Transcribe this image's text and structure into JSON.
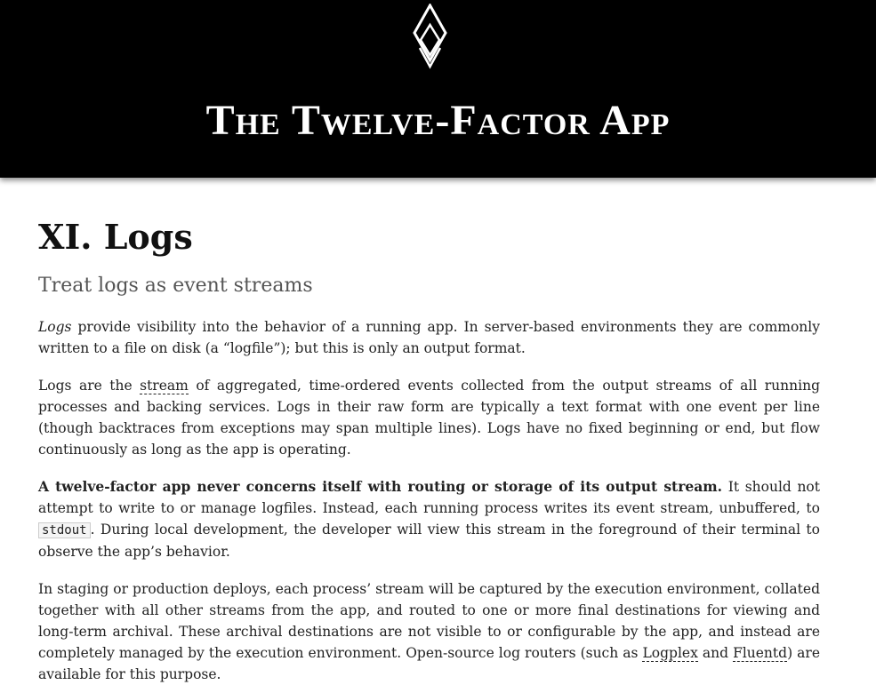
{
  "header": {
    "logo_icon": "diamond-logo-icon",
    "title": "The Twelve-Factor App"
  },
  "article": {
    "title": "XI. Logs",
    "subtitle": "Treat logs as event streams",
    "p1": {
      "em": "Logs",
      "text": " provide visibility into the behavior of a running app. In server-based environments they are commonly written to a file on disk (a “logfile”); but this is only an output format."
    },
    "p2": {
      "before": "Logs are the ",
      "link": "stream",
      "after": " of aggregated, time-ordered events collected from the output streams of all running processes and backing services. Logs in their raw form are typically a text format with one event per line (though backtraces from exceptions may span multiple lines). Logs have no fixed beginning or end, but flow continuously as long as the app is operating."
    },
    "p3": {
      "strong": "A twelve-factor app never concerns itself with routing or storage of its output stream.",
      "before_code": " It should not attempt to write to or manage logfiles. Instead, each running process writes its event stream, unbuffered, to ",
      "code": "stdout",
      "after_code": ". During local development, the developer will view this stream in the foreground of their terminal to observe the app’s behavior."
    },
    "p4": {
      "before": "In staging or production deploys, each process’ stream will be captured by the execution environment, collated together with all other streams from the app, and routed to one or more final destinations for viewing and long-term archival. These archival destinations are not visible to or configurable by the app, and instead are completely managed by the execution environment. Open-source log routers (such as ",
      "link1": "Logplex",
      "mid": " and ",
      "link2": "Fluentd",
      "after": ") are available for this purpose."
    }
  }
}
